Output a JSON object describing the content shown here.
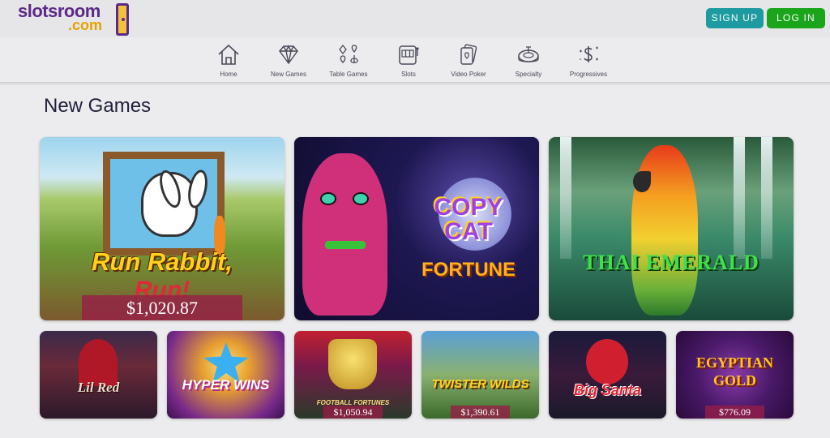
{
  "header": {
    "logo_line1": "slotsroom",
    "logo_line2": ".com",
    "signup_label": "SIGN UP",
    "login_label": "LOG IN"
  },
  "nav": {
    "items": [
      {
        "label": "Home",
        "icon": "home-icon"
      },
      {
        "label": "New Games",
        "icon": "diamond-icon"
      },
      {
        "label": "Table Games",
        "icon": "card-suits-icon"
      },
      {
        "label": "Slots",
        "icon": "slot-machine-icon"
      },
      {
        "label": "Video Poker",
        "icon": "playing-cards-icon"
      },
      {
        "label": "Specialty",
        "icon": "roulette-icon"
      },
      {
        "label": "Progressives",
        "icon": "dollar-sparkle-icon"
      }
    ]
  },
  "section": {
    "title": "New Games"
  },
  "games": {
    "featured": [
      {
        "title": "Run Rabbit,",
        "title2": "Run!",
        "jackpot": "$1,020.87"
      },
      {
        "title": "COPY CAT",
        "title2": "FORTUNE"
      },
      {
        "title": "THAI EMERALD"
      }
    ],
    "small": [
      {
        "title": "Lil Red"
      },
      {
        "title": "HYPER WINS"
      },
      {
        "title": "FOOTBALL FORTUNES",
        "jackpot": "$1,050.94"
      },
      {
        "title": "TWISTER WILDS",
        "jackpot": "$1,390.61"
      },
      {
        "title": "Big Santa"
      },
      {
        "title": "EGYPTIAN GOLD",
        "jackpot": "$776.09"
      }
    ]
  },
  "colors": {
    "brand_purple": "#5b2a86",
    "brand_gold": "#e6a100",
    "signup_teal": "#1e9ba0",
    "login_green": "#1aa51a",
    "jackpot_bg": "#961e46"
  }
}
